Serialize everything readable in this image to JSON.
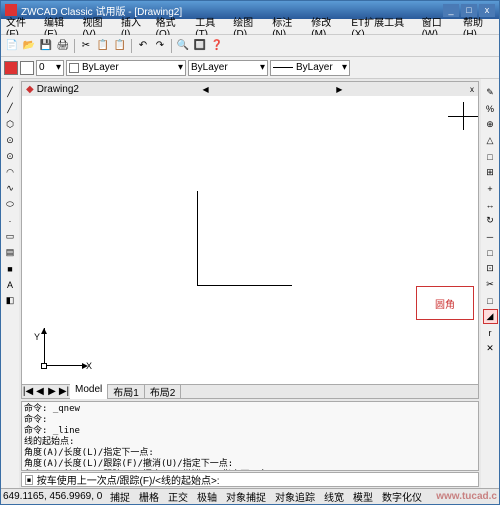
{
  "title": "ZWCAD Classic 试用版 - [Drawing2]",
  "window_controls": {
    "min": "_",
    "max": "□",
    "close": "x"
  },
  "menu": [
    "文件(F)",
    "编辑(E)",
    "视图(V)",
    "插入(I)",
    "格式(O)",
    "工具(T)",
    "绘图(D)",
    "标注(N)",
    "修改(M)",
    "ET扩展工具(X)",
    "窗口(W)",
    "帮助(H)"
  ],
  "toolbar_icons": [
    "📄",
    "📂",
    "💾",
    "🖨",
    "✂",
    "📋",
    "📋",
    "↶",
    "↷",
    "🔍",
    "🔲",
    "❓"
  ],
  "layer_combo": {
    "color": "#ffffff",
    "text": "0"
  },
  "prop_combos": {
    "color_label": "ByLayer",
    "linetype_label": "ByLayer",
    "lineweight_label": "ByLayer"
  },
  "doc_tab": "Drawing2",
  "left_tool_icons": [
    "╱",
    "╱",
    "⬡",
    "⊙",
    "⊙",
    "◠",
    "∿",
    "⬭",
    "·",
    "▭",
    "▤",
    "■",
    "A",
    "◧"
  ],
  "right_tool_icons": [
    "✎",
    "%",
    "⊕",
    "△",
    "□",
    "⊞",
    "+",
    "↔",
    "↻",
    "─",
    "□",
    "⊡",
    "✂",
    "□",
    "◢",
    "r",
    "✕"
  ],
  "fillet_index": 14,
  "ucs": {
    "x": "X",
    "y": "Y"
  },
  "annotation_label": "圆角",
  "model_tabs": {
    "nav": [
      "|◀",
      "◀",
      "▶",
      "▶|"
    ],
    "tabs": [
      "Model",
      "布局1",
      "布局2"
    ]
  },
  "command_history": "命令: _qnew\n命令:\n命令: _line\n线的起始点:\n角度(A)/长度(L)/指定下一点:\n角度(A)/长度(L)/跟踪(F)/撤消(U)/指定下一点:\n角度(A)/长度(L)/跟踪(F)/闭合(C)/撤消(U)/指定下一点:\n命令: _line",
  "command_prompt": "▣ 按车使用上一次点/跟踪(F)/<线的起始点>:",
  "status": {
    "coord": "649.1165, 456.9969, 0",
    "buttons": [
      "捕捉",
      "栅格",
      "正交",
      "极轴",
      "对象捕捉",
      "对象追踪",
      "线宽",
      "模型",
      "数字化仪"
    ],
    "watermark": "www.tucad.c"
  }
}
